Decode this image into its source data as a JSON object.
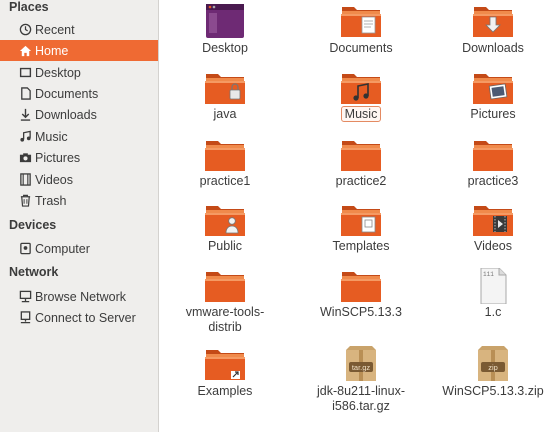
{
  "sidebar": {
    "places_heading": "Places",
    "places": [
      {
        "label": "Recent",
        "icon": "clock-icon"
      },
      {
        "label": "Home",
        "icon": "home-icon",
        "active": true
      },
      {
        "label": "Desktop",
        "icon": "desktop-folder-icon"
      },
      {
        "label": "Documents",
        "icon": "document-icon"
      },
      {
        "label": "Downloads",
        "icon": "download-arrow-icon"
      },
      {
        "label": "Music",
        "icon": "music-note-icon"
      },
      {
        "label": "Pictures",
        "icon": "camera-icon"
      },
      {
        "label": "Videos",
        "icon": "film-icon"
      },
      {
        "label": "Trash",
        "icon": "trash-icon"
      }
    ],
    "devices_heading": "Devices",
    "devices": [
      {
        "label": "Computer",
        "icon": "harddisk-icon"
      }
    ],
    "network_heading": "Network",
    "network": [
      {
        "label": "Browse Network",
        "icon": "network-icon"
      },
      {
        "label": "Connect to Server",
        "icon": "server-icon"
      }
    ]
  },
  "files": [
    {
      "label": "Desktop",
      "icon": "desktop-icon"
    },
    {
      "label": "Documents",
      "icon": "documents-folder-icon"
    },
    {
      "label": "Downloads",
      "icon": "downloads-folder-icon"
    },
    {
      "label": "java",
      "icon": "locked-folder-icon"
    },
    {
      "label": "Music",
      "icon": "music-folder-icon",
      "selected": true
    },
    {
      "label": "Pictures",
      "icon": "pictures-folder-icon"
    },
    {
      "label": "practice1",
      "icon": "folder-icon"
    },
    {
      "label": "practice2",
      "icon": "folder-icon"
    },
    {
      "label": "practice3",
      "icon": "folder-icon"
    },
    {
      "label": "Public",
      "icon": "public-folder-icon"
    },
    {
      "label": "Templates",
      "icon": "templates-folder-icon"
    },
    {
      "label": "Videos",
      "icon": "videos-folder-icon"
    },
    {
      "label": "vmware-tools-\ndistrib",
      "icon": "folder-icon"
    },
    {
      "label": "WinSCP5.13.3",
      "icon": "folder-icon"
    },
    {
      "label": "1.c",
      "icon": "text-file-icon",
      "badge": "111"
    },
    {
      "label": "Examples",
      "icon": "symlink-folder-icon"
    },
    {
      "label": "jdk-8u211-linux-\ni586.tar.gz",
      "icon": "archive-icon",
      "badge": "tar.gz"
    },
    {
      "label": "WinSCP5.13.3.zip",
      "icon": "archive-icon",
      "badge": "zip"
    }
  ],
  "colors": {
    "accent": "#ef6a33",
    "folder_top": "#f08a4b",
    "folder_body": "#e65c22",
    "sidebar_bg": "#efeeec"
  }
}
